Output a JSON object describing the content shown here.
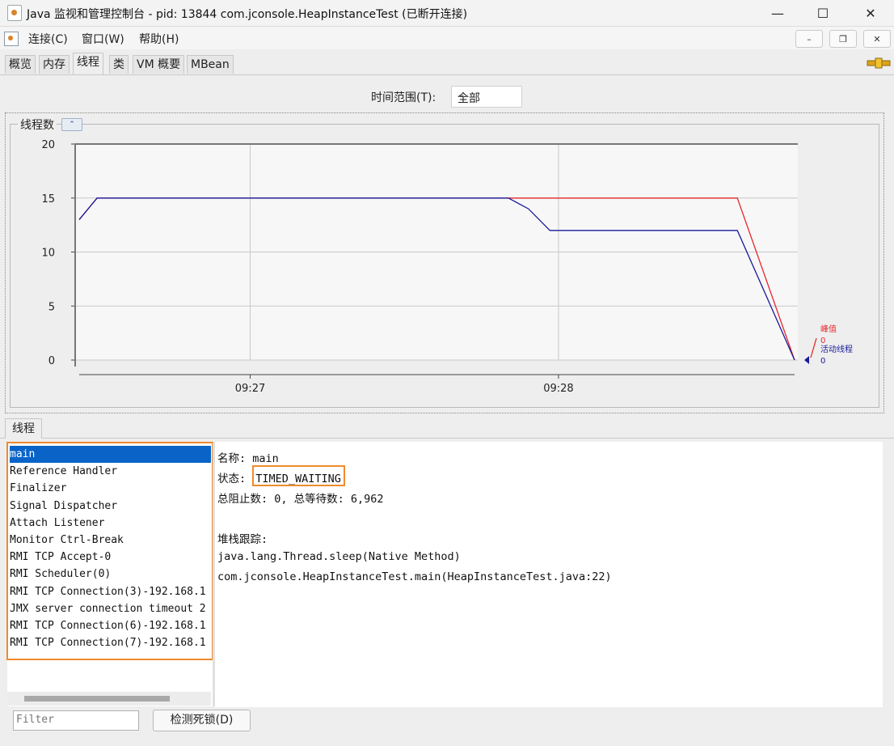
{
  "window": {
    "title": "Java 监视和管理控制台 - pid: 13844 com.jconsole.HeapInstanceTest (已断开连接)",
    "controls": {
      "minimize": "—",
      "maximize": "☐",
      "close": "✕"
    }
  },
  "menubar": {
    "items": [
      "连接(C)",
      "窗口(W)",
      "帮助(H)"
    ],
    "mdi_controls": [
      "–",
      "❐",
      "✕"
    ]
  },
  "tabs": [
    "概览",
    "内存",
    "线程",
    "类",
    "VM 概要",
    "MBean"
  ],
  "active_tab": "线程",
  "time_range": {
    "label": "时间范围(T):",
    "value": "全部"
  },
  "chart_panel": {
    "title": "线程数"
  },
  "chart_data": {
    "type": "line",
    "ylim": [
      0,
      20
    ],
    "yticks": [
      "20",
      "15",
      "10",
      "5",
      "0"
    ],
    "xticks": [
      "09:27",
      "09:28"
    ],
    "grid": true,
    "legend_placement": "right",
    "series": [
      {
        "name": "峰值",
        "color": "#e8262b",
        "current": "0",
        "points": [
          [
            0.0,
            13
          ],
          [
            0.025,
            15
          ],
          [
            0.6,
            15
          ],
          [
            0.92,
            15
          ],
          [
            1.0,
            0
          ]
        ]
      },
      {
        "name": "活动线程",
        "color": "#1a1a9a",
        "current": "0",
        "points": [
          [
            0.0,
            13
          ],
          [
            0.025,
            15
          ],
          [
            0.6,
            15
          ],
          [
            0.628,
            14
          ],
          [
            0.658,
            12
          ],
          [
            0.92,
            12
          ],
          [
            1.0,
            0
          ]
        ]
      }
    ]
  },
  "threads_panel": {
    "tab_label": "线程",
    "threads": [
      "main",
      "Reference Handler",
      "Finalizer",
      "Signal Dispatcher",
      "Attach Listener",
      "Monitor Ctrl-Break",
      "RMI TCP Accept-0",
      "RMI Scheduler(0)",
      "RMI TCP Connection(3)-192.168.1",
      "JMX server connection timeout 2",
      "RMI TCP Connection(6)-192.168.1",
      "RMI TCP Connection(7)-192.168.1"
    ],
    "selected_index": 0,
    "filter_placeholder": "Filter",
    "detect_button": "检测死锁(D)"
  },
  "details": {
    "name_line": "名称: main",
    "state_label": "状态: ",
    "state_value": "TIMED_WAITING",
    "counts_line": "总阻止数: 0, 总等待数: 6,962",
    "stack_title": "堆栈跟踪:",
    "stack": [
      "java.lang.Thread.sleep(Native Method)",
      "com.jconsole.HeapInstanceTest.main(HeapInstanceTest.java:22)"
    ]
  }
}
